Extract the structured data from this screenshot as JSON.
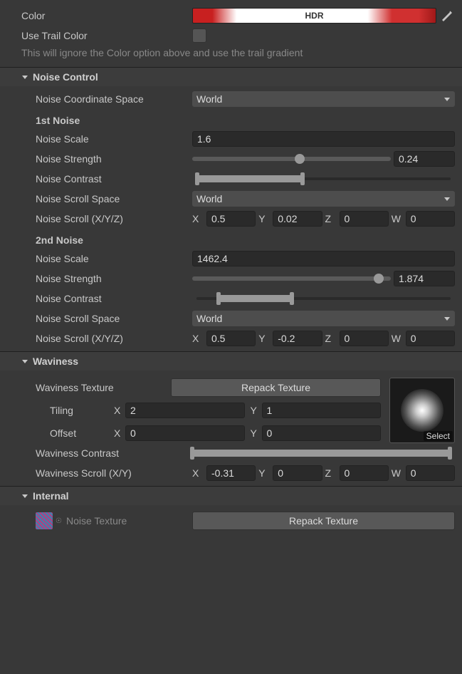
{
  "top": {
    "color_label": "Color",
    "use_trail_label": "Use Trail Color",
    "hdr_label": "HDR",
    "hint": "This will ignore the Color option above and use the trail gradient"
  },
  "noise_control": {
    "title": "Noise Control",
    "coord_space_label": "Noise Coordinate Space",
    "coord_space_value": "World",
    "noise1_heading": "1st Noise",
    "noise2_heading": "2nd Noise",
    "scale_label": "Noise Scale",
    "strength_label": "Noise Strength",
    "contrast_label": "Noise Contrast",
    "scroll_space_label": "Noise Scroll Space",
    "scroll_space_value": "World",
    "scroll_label": "Noise Scroll (X/Y/Z)",
    "noise1": {
      "scale": "1.6",
      "strength": "0.24",
      "strength_pct": 54,
      "contrast_lo": 2,
      "contrast_hi": 42,
      "x": "0.5",
      "y": "0.02",
      "z": "0",
      "w": "0"
    },
    "noise2": {
      "scale": "1462.4",
      "strength": "1.874",
      "strength_pct": 94,
      "contrast_lo": 10,
      "contrast_hi": 38,
      "x": "0.5",
      "y": "-0.2",
      "z": "0",
      "w": "0"
    }
  },
  "waviness": {
    "title": "Waviness",
    "texture_label": "Waviness Texture",
    "repack_label": "Repack Texture",
    "select_label": "Select",
    "tiling_label": "Tiling",
    "offset_label": "Offset",
    "tiling_x": "2",
    "tiling_y": "1",
    "offset_x": "0",
    "offset_y": "0",
    "contrast_label": "Waviness Contrast",
    "scroll_label": "Waviness Scroll (X/Y)",
    "scroll": {
      "x": "-0.31",
      "y": "0",
      "z": "0",
      "w": "0"
    }
  },
  "internal": {
    "title": "Internal",
    "noise_texture_label": "Noise Texture",
    "repack_label": "Repack Texture"
  },
  "axis": {
    "x": "X",
    "y": "Y",
    "z": "Z",
    "w": "W"
  }
}
